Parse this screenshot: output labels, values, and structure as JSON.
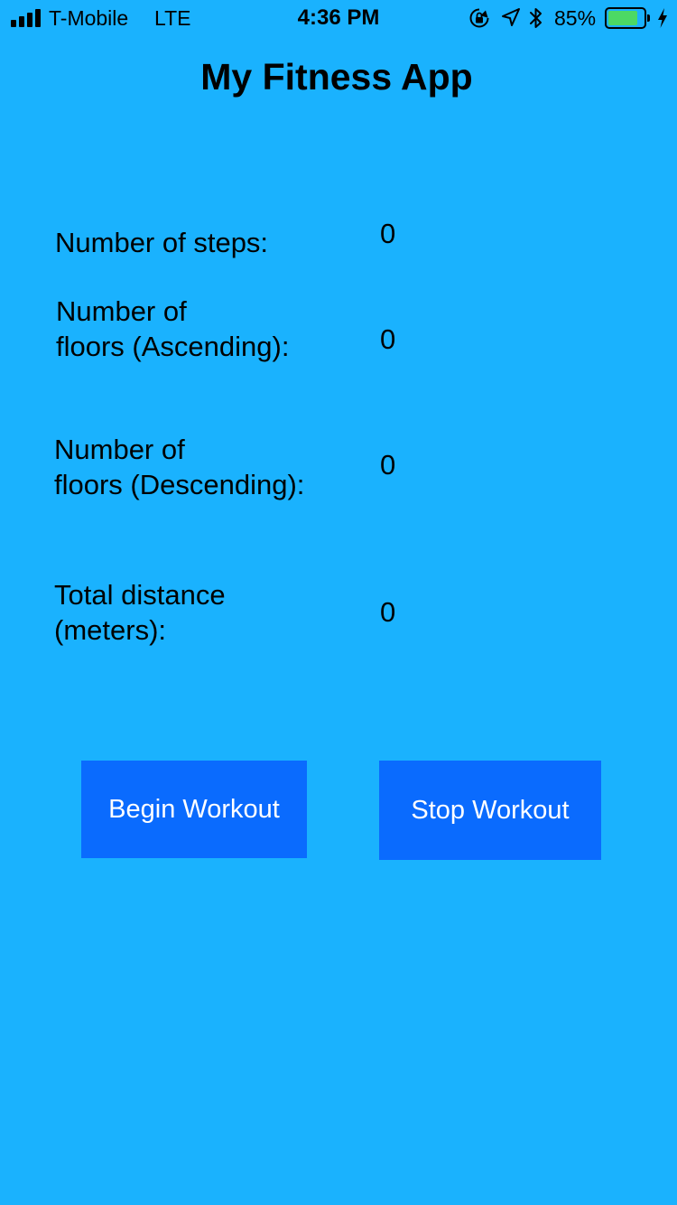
{
  "status_bar": {
    "carrier": "T-Mobile",
    "network": "LTE",
    "time": "4:36 PM",
    "battery_percent": "85%",
    "battery_level": 0.85,
    "battery_color": "#4CD964",
    "signal_bars": 4,
    "icons": [
      "signal-icon",
      "rotation-lock-icon",
      "location-icon",
      "bluetooth-icon",
      "battery-icon",
      "charging-icon"
    ]
  },
  "app": {
    "title": "My Fitness App",
    "background_color": "#1AB2FE",
    "button_color": "#0A6BFE"
  },
  "stats": {
    "steps": {
      "label_line1": "Number of steps:",
      "value": "0"
    },
    "floors_ascending": {
      "label_line1": "Number of",
      "label_line2": "floors (Ascending):",
      "value": "0"
    },
    "floors_descending": {
      "label_line1": "Number of",
      "label_line2": "floors (Descending):",
      "value": "0"
    },
    "distance": {
      "label_line1": "Total distance",
      "label_line2": "(meters):",
      "value": "0"
    }
  },
  "buttons": {
    "begin_label": "Begin Workout",
    "stop_label": "Stop Workout"
  }
}
